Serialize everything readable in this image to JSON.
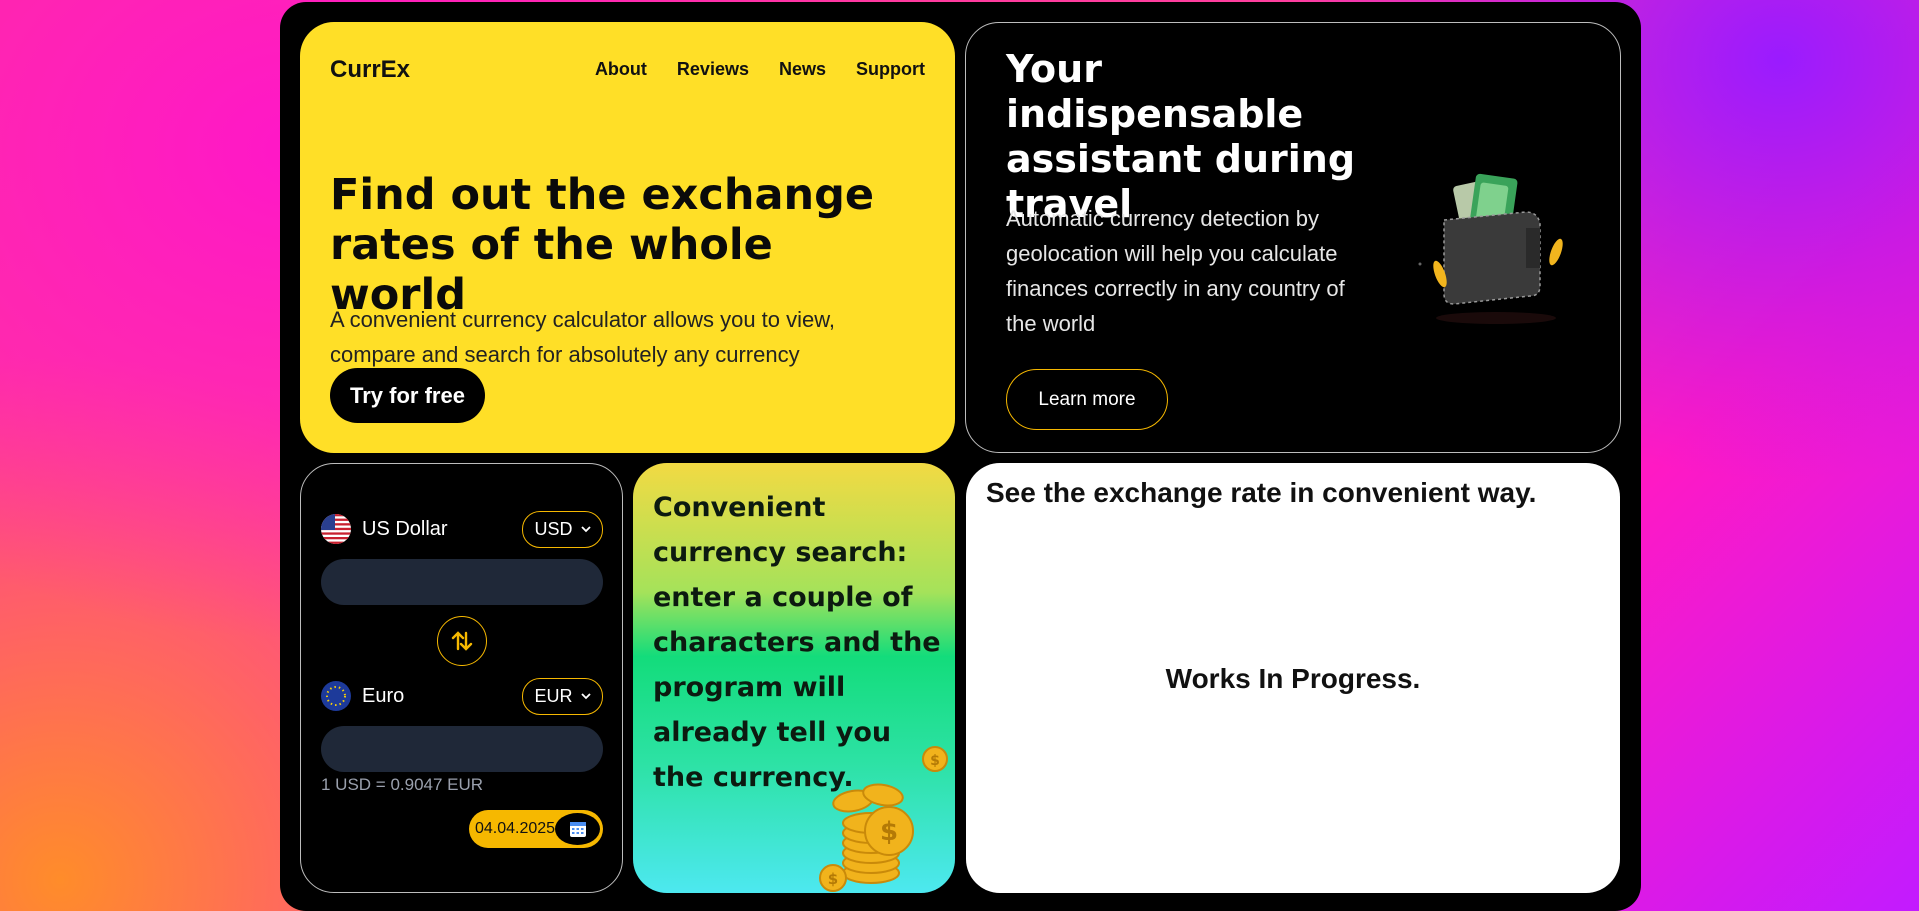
{
  "app": {
    "name": "CurrEx"
  },
  "nav": [
    "About",
    "Reviews",
    "News",
    "Support"
  ],
  "hero": {
    "title": "Find out the exchange rates of the whole world",
    "subtitle": "A convenient currency calculator allows you to view, compare and search for absolutely any currency",
    "cta": "Try for free"
  },
  "travel": {
    "title": "Your indispensable assistant during travel",
    "text": "Automatic currency detection by geolocation will help you calculate finances correctly in any country of the world",
    "cta": "Learn more"
  },
  "converter": {
    "from": {
      "name": "US Dollar",
      "code": "USD",
      "value": ""
    },
    "to": {
      "name": "Euro",
      "code": "EUR",
      "value": ""
    },
    "rate": "1 USD = 0.9047 EUR",
    "date": "04.04.2025"
  },
  "search_card": {
    "text": "Convenient currency search: enter a couple of characters and the program will already tell you the currency."
  },
  "exchange": {
    "title": "See the exchange rate in convenient way.",
    "status": "Works In Progress."
  },
  "colors": {
    "accent": "#ffdf27",
    "outline": "#f6b800",
    "dark": "#000000",
    "field": "#1f2838"
  },
  "icons": [
    "us-flag-icon",
    "eu-flag-icon",
    "swap-arrows-icon",
    "calendar-icon",
    "chevron-down-icon",
    "wallet-illustration",
    "coins-illustration"
  ]
}
